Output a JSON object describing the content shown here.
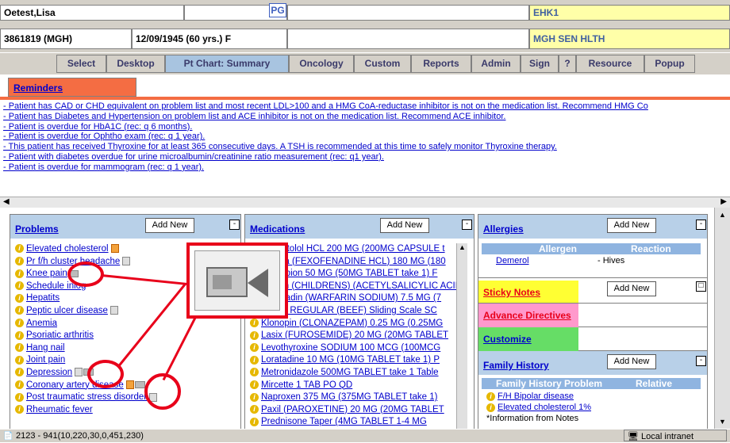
{
  "header": {
    "patient_name": "Oetest,Lisa",
    "mrn": "3861819 (MGH)",
    "dob_info": "12/09/1945 (60 yrs.) F",
    "pg_badge": "PG",
    "unit_code": "EHK1",
    "unit_name": "MGH SEN HLTH"
  },
  "nav": {
    "select": "Select",
    "desktop": "Desktop",
    "summary": "Pt Chart: Summary",
    "oncology": "Oncology",
    "custom": "Custom",
    "reports": "Reports",
    "admin": "Admin",
    "sign": "Sign",
    "help": "?",
    "resource": "Resource",
    "popup": "Popup"
  },
  "reminders": {
    "tab": "Reminders",
    "items": [
      "- Patient has CAD or CHD equivalent on problem list and most recent LDL>100 and a HMG CoA-reductase inhibitor is not on the medication list. Recommend HMG Co",
      "- Patient has Diabetes and Hypertension on problem list and ACE inhibitor is not on the medication list. Recommend ACE inhibitor.",
      "- Patient is overdue for HbA1C (rec: q 6 months).",
      "- Patient is overdue for Ophtho exam (rec: q 1 year).",
      "- This patient has received Thyroxine for at least 365 consecutive days. A TSH is recommended at this time to safely monitor Thyroxine therapy.",
      "- Patient with diabetes overdue for urine microalbumin/creatinine ratio measurement (rec: q1 year).",
      "- Patient is overdue for mammogram (rec: q 1 year)."
    ]
  },
  "problems": {
    "title": "Problems",
    "add_new": "Add New",
    "min": "-",
    "items": [
      "Elevated cholesterol",
      "Pr f/h cluster headache",
      "Knee pain",
      "Schedule inlog",
      "Hepatits",
      "Peptic ulcer disease",
      "Anemia",
      "Psoriatic arthritis",
      "Hang nail",
      "Joint pain",
      "Depression",
      "Coronary artery disease",
      "Post traumatic stress disorder",
      "Rheumatic fever"
    ]
  },
  "medications": {
    "title": "Medications",
    "add_new": "Add New",
    "min": "-",
    "items": [
      "Acebutolol HCL 200 MG (200MG CAPSULE t",
      "Allegra (FEXOFENADINE HCL) 180 MG (180",
      "Bupropion 50 MG (50MG TABLET take 1) F",
      "Aspirin (CHILDRENS) (ACETYLSALICYLIC ACID",
      "Coumadin (WARFARIN SODIUM) 7.5 MG (7",
      "Insulin REGULAR (BEEF) Sliding Scale SC",
      "Klonopin (CLONAZEPAM) 0.25 MG (0.25MG",
      "Lasix (FUROSEMIDE) 20 MG (20MG TABLET",
      "Levothyroxine SODIUM 100 MCG (100MCG",
      "Loratadine 10 MG (10MG TABLET take 1) P",
      "Metronidazole 500MG TABLET take 1 Table",
      "Mircette 1 TAB PO QD",
      "Naproxen 375 MG (375MG TABLET take 1)",
      "Paxil (PAROXETINE) 20 MG (20MG TABLET",
      "Prednisone Taper (4MG TABLET 1-4 MG"
    ]
  },
  "allergies": {
    "title": "Allergies",
    "add_new": "Add New",
    "min": "-",
    "col_allergen": "Allergen",
    "col_reaction": "Reaction",
    "allergen": "Demerol",
    "reaction": "- Hives"
  },
  "sticky": {
    "title": "Sticky Notes",
    "add_new": "Add New"
  },
  "advance": {
    "title": "Advance Directives"
  },
  "customize": {
    "title": "Customize"
  },
  "family": {
    "title": "Family History",
    "add_new": "Add New",
    "min": "-",
    "col_problem": "Family History Problem",
    "col_relative": "Relative",
    "items": [
      "F/H Bipolar disease",
      "Elevated cholesterol 1%"
    ],
    "info_note": "*Information from Notes"
  },
  "status": {
    "text": "2123 - 941(10,220,30,0,451,230)",
    "zone": "Local intranet"
  },
  "colors": {
    "reminder_tab": "#f46d43",
    "sticky_tab": "#ffff33",
    "advance_tab": "#ff99cc",
    "customize_tab": "#66dd66",
    "annotation": "#e8001a"
  }
}
